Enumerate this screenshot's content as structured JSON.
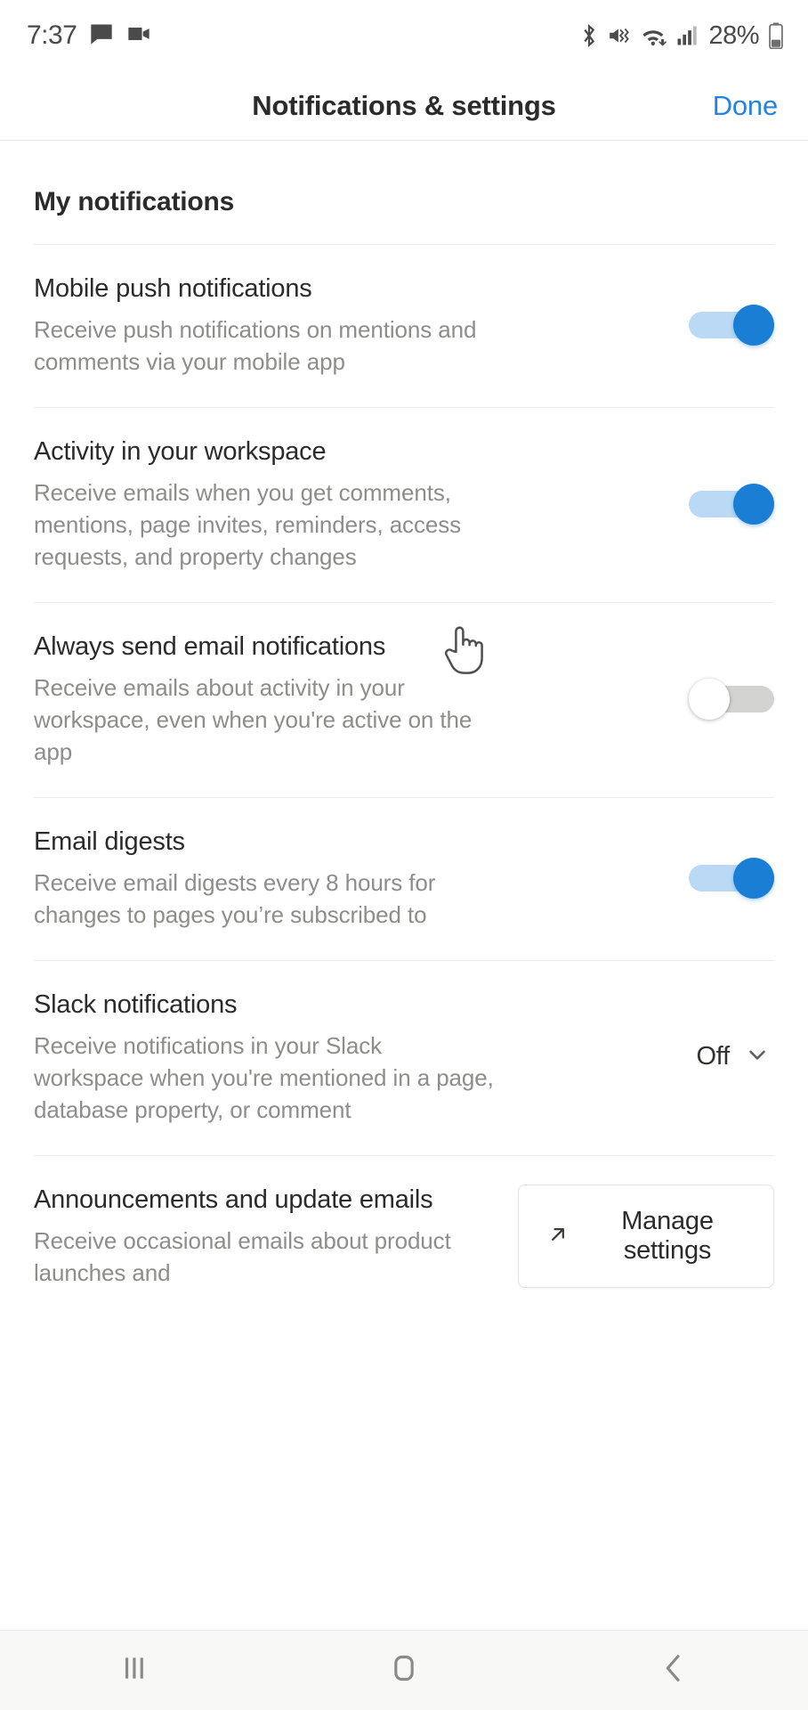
{
  "status_bar": {
    "time": "7:37",
    "battery_percent": "28%",
    "icons": [
      "message-icon",
      "video-camera-icon",
      "bluetooth-icon",
      "mute-vibrate-icon",
      "wifi-icon",
      "cellular-signal-icon",
      "battery-icon"
    ]
  },
  "header": {
    "title": "Notifications & settings",
    "done_label": "Done"
  },
  "main": {
    "section_title": "My notifications",
    "rows": [
      {
        "title": "Mobile push notifications",
        "desc": "Receive push notifications on mentions and comments via your mobile app",
        "control": "toggle",
        "state": "on"
      },
      {
        "title": "Activity in your workspace",
        "desc": "Receive emails when you get comments, mentions, page invites, reminders, access requests, and property changes",
        "control": "toggle",
        "state": "on"
      },
      {
        "title": "Always send email notifications",
        "desc": "Receive emails about activity in your workspace, even when you're active on the app",
        "control": "toggle",
        "state": "off"
      },
      {
        "title": "Email digests",
        "desc": "Receive email digests every 8 hours for changes to pages you’re subscribed to",
        "control": "toggle",
        "state": "on"
      },
      {
        "title": "Slack notifications",
        "desc": "Receive notifications in your Slack workspace when you're mentioned in a page, database property, or comment",
        "control": "select",
        "value": "Off"
      },
      {
        "title": "Announcements and update emails",
        "desc": "Receive occasional emails about product launches and",
        "control": "button",
        "button_label": "Manage settings"
      }
    ]
  },
  "nav_bar": {
    "recents_label": "recents-icon",
    "home_label": "home-icon",
    "back_label": "back-icon"
  },
  "colors": {
    "accent": "#2383e2",
    "toggle_on": "#1a7fd4",
    "toggle_track_on": "#b9d9f5",
    "toggle_track_off": "#d3d3d1",
    "text_primary": "#2b2b2b",
    "text_secondary": "#8d8d8a"
  }
}
